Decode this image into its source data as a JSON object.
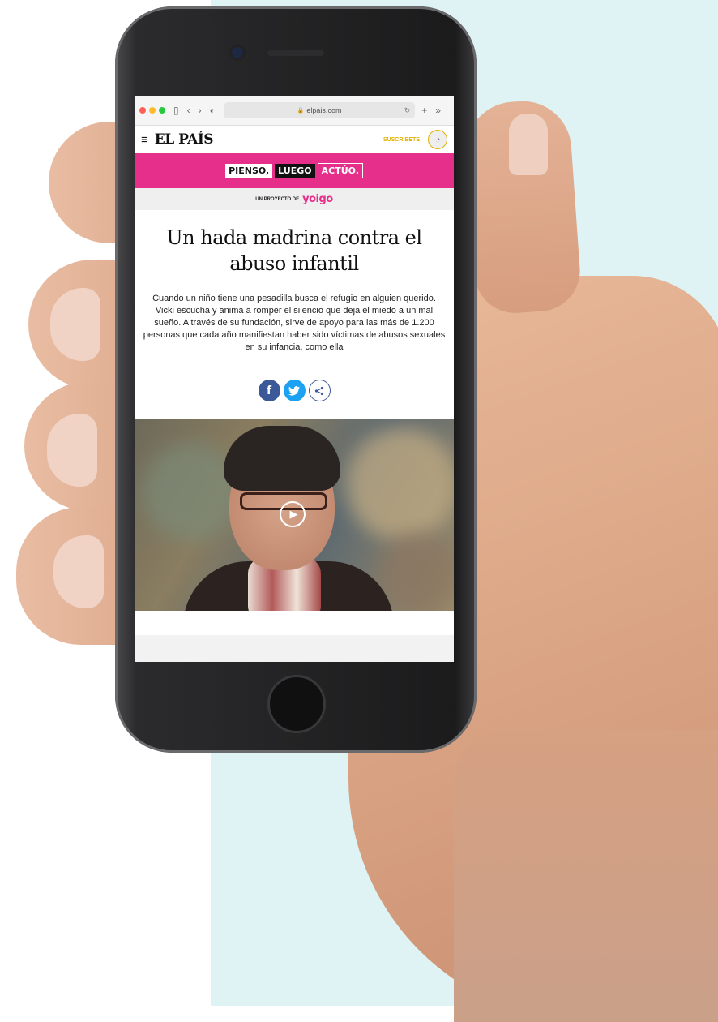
{
  "browser": {
    "url": "elpais.com",
    "nav_back": "‹",
    "nav_forward": "›",
    "sidebar_icon": "sidebar-icon",
    "shield_icon": "◐",
    "new_tab": "+",
    "more": "»"
  },
  "header": {
    "menu_icon": "≡",
    "logo": "EL PAÍS",
    "subscribe": "SUSCRÍBETE"
  },
  "campaign": {
    "word1": "PIENSO,",
    "word2": "LUEGO",
    "word3": "ACTÚO.",
    "project_label": "UN PROYECTO DE",
    "brand": "yoigo"
  },
  "article": {
    "headline": "Un hada madrina contra el abuso infantil",
    "lead": "Cuando un niño tiene una pesadilla busca el refugio en alguien querido. Vicki escucha y anima a romper el silencio que deja el miedo a un mal sueño. A través de su fundación, sirve de apoyo para las más de 1.200 personas que cada año manifiestan haber sido víctimas de abusos sexuales en su infancia, como ella"
  },
  "share": {
    "facebook": "f",
    "twitter": "🐦",
    "share": "⋖"
  },
  "colors": {
    "brand_pink": "#e52f8a",
    "subscribe_yellow": "#e4b100",
    "facebook_blue": "#3b5998",
    "twitter_blue": "#1da1f2",
    "background_panel": "#dff3f4"
  }
}
